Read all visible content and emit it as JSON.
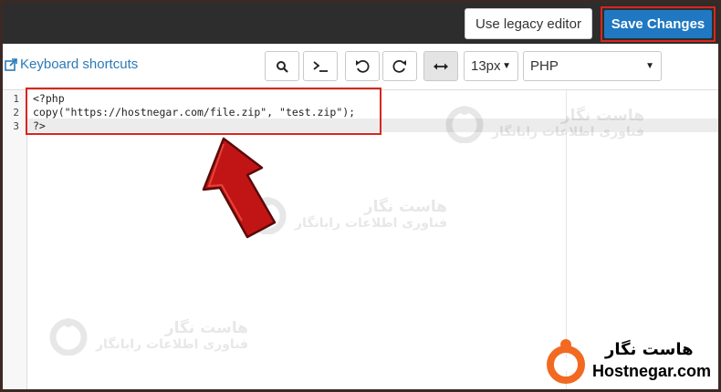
{
  "header": {
    "legacy_button_label": "Use legacy editor",
    "save_button_label": "Save Changes"
  },
  "toolbar": {
    "keyboard_shortcuts_label": "Keyboard shortcuts",
    "search_icon": "search-icon",
    "console_icon": "terminal-icon",
    "undo_icon": "undo-icon",
    "redo_icon": "redo-icon",
    "wrap_icon": "horizontal-arrows-icon",
    "font_size_value": "13px",
    "language_value": "PHP"
  },
  "editor": {
    "line_numbers": [
      "1",
      "2",
      "3"
    ],
    "lines": [
      "<?php",
      "copy(\"https://hostnegar.com/file.zip\", \"test.zip\");",
      "?>"
    ]
  },
  "watermark": {
    "line1": "هاست نگار",
    "line2": "فناوری اطلاعات رایانگار"
  },
  "brand": {
    "name_fa": "هاست نگار",
    "name_en": "Hostnegar.com"
  },
  "colors": {
    "topbar": "#2d2d2d",
    "save_button": "#1f78c1",
    "highlight_red": "#d9251c",
    "link_blue": "#2a7ab8",
    "brand_orange": "#f26a21"
  }
}
